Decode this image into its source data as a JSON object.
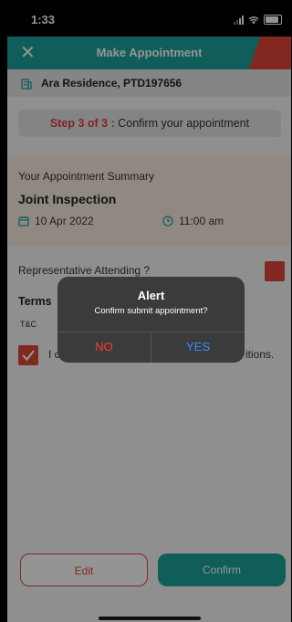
{
  "status_bar": {
    "time": "1:33"
  },
  "header": {
    "title": "Make Appointment",
    "close_icon": "close-icon",
    "accent_color": "#e2453a",
    "brand_color": "#1ba39c"
  },
  "residence": {
    "name": "Ara Residence, PTD197656",
    "icon": "building-icon"
  },
  "step": {
    "label": "Step 3 of 3 :",
    "text": "Confirm your appointment"
  },
  "summary": {
    "heading": "Your Appointment Summary",
    "type": "Joint Inspection",
    "date": "10 Apr 2022",
    "time": "11:00 am"
  },
  "representative": {
    "label": "Representative Attending ?"
  },
  "terms": {
    "heading": "Terms",
    "tnc": "T&C",
    "agree_prefix": "I c",
    "agree_suffix": "itions."
  },
  "buttons": {
    "edit": "Edit",
    "confirm": "Confirm"
  },
  "alert": {
    "title": "Alert",
    "message": "Confirm submit appointment?",
    "no": "NO",
    "yes": "YES"
  }
}
